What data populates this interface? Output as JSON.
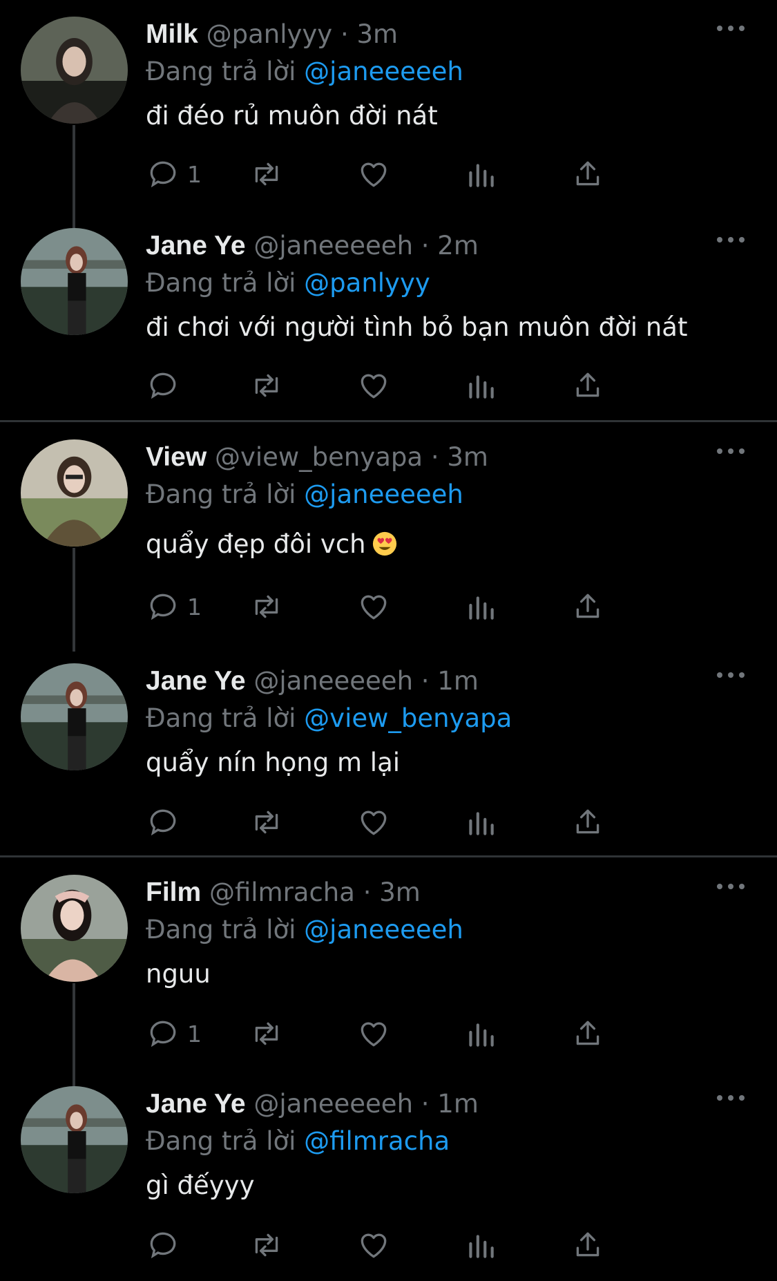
{
  "reply_prefix": "Đang trả lời",
  "tweets": [
    {
      "name": "Milk",
      "handle": "@panlyyy",
      "time": "· 3m",
      "reply_to": "@janeeeeeh",
      "text": "đi đéo rủ muôn đời nát",
      "reply_count": "1",
      "avatar_colors": [
        "#6d7466",
        "#1c1e1a",
        "#3a3430"
      ]
    },
    {
      "name": "Jane Ye",
      "handle": "@janeeeeeh",
      "time": "· 2m",
      "reply_to": "@panlyyy",
      "text": "đi chơi với người tình bỏ bạn muôn đời nát",
      "reply_count": "",
      "avatar_colors": [
        "#7d8e8c",
        "#2d3a30",
        "#111111"
      ]
    },
    {
      "name": "View",
      "handle": "@view_benyapa",
      "time": "· 3m",
      "reply_to": "@janeeeeeh",
      "text": "quẩy đẹp đôi vch",
      "reply_count": "1",
      "avatar_colors": [
        "#c4bfb0",
        "#7a8a5c",
        "#5f5238"
      ]
    },
    {
      "name": "Jane Ye",
      "handle": "@janeeeeeh",
      "time": "· 1m",
      "reply_to": "@view_benyapa",
      "text": "quẩy nín họng m lại",
      "reply_count": "",
      "avatar_colors": [
        "#7d8e8c",
        "#2d3a30",
        "#111111"
      ]
    },
    {
      "name": "Film",
      "handle": "@filmracha",
      "time": "· 3m",
      "reply_to": "@janeeeeeh",
      "text": "nguu",
      "reply_count": "1",
      "avatar_colors": [
        "#9aa29a",
        "#4f5c46",
        "#d9b5a4"
      ]
    },
    {
      "name": "Jane Ye",
      "handle": "@janeeeeeh",
      "time": "· 1m",
      "reply_to": "@filmracha",
      "text": "gì đếyyy",
      "reply_count": "",
      "avatar_colors": [
        "#7d8e8c",
        "#2d3a30",
        "#111111"
      ]
    }
  ],
  "icons": {
    "reply": "reply-icon",
    "retweet": "retweet-icon",
    "like": "like-icon",
    "views": "views-icon",
    "share": "share-icon",
    "more": "more-icon",
    "emoji": "heart-eyes-emoji"
  },
  "colors": {
    "background": "#000000",
    "text": "#e7e9ea",
    "muted": "#71767b",
    "mention": "#1d9bf0",
    "divider": "#2f3336"
  }
}
